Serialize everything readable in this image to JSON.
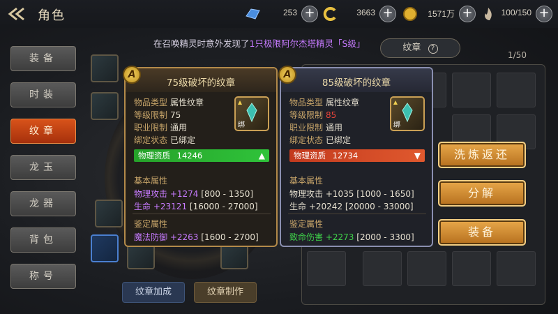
{
  "header": {
    "title": "角色"
  },
  "resources": [
    {
      "icon": "blue-crystal-icon",
      "value": "253"
    },
    {
      "icon": "gold-swirl-icon",
      "value": "3663"
    },
    {
      "icon": "gold-coin-icon",
      "value": "1571万"
    },
    {
      "icon": "flame-stamina-icon",
      "value": "100/150"
    }
  ],
  "notice": {
    "prefix": "在召唤精灵时意外发现了",
    "highlight": "1只极限阿尔杰塔精灵「S级」"
  },
  "tabs": [
    {
      "label": "装备",
      "active": false
    },
    {
      "label": "时装",
      "active": false
    },
    {
      "label": "纹章",
      "active": true
    },
    {
      "label": "龙玉",
      "active": false
    },
    {
      "label": "龙器",
      "active": false
    },
    {
      "label": "背包",
      "active": false
    },
    {
      "label": "称号",
      "active": false
    }
  ],
  "emblem_buttons": {
    "bonus": "纹章加成",
    "craft": "纹章制作"
  },
  "inventory": {
    "tab_label": "纹章",
    "count": "1/50"
  },
  "actions": {
    "refine": "洗炼返还",
    "decompose": "分解",
    "equip": "装备"
  },
  "tooltip_left": {
    "badge": "A",
    "title": "75级破坏的纹章",
    "bound_label": "绑",
    "rows": [
      {
        "k": "物品类型",
        "v": "属性纹章"
      },
      {
        "k": "等级限制",
        "v": "75"
      },
      {
        "k": "职业限制",
        "v": "通用"
      },
      {
        "k": "绑定状态",
        "v": "已绑定"
      }
    ],
    "quality": {
      "label": "物理资质",
      "value": "14246",
      "arrow": "▲"
    },
    "basic_title": "基本属性",
    "basic": [
      {
        "name": "物理攻击",
        "bonus": "+1274",
        "range": "[800 - 1350]"
      },
      {
        "name": "生命",
        "bonus": "+23121",
        "range": "[16000 - 27000]"
      }
    ],
    "appraise_title": "鉴定属性",
    "appraise": [
      {
        "name": "魔法防御",
        "bonus": "+2263",
        "range": "[1600 - 2700]"
      }
    ]
  },
  "tooltip_right": {
    "badge": "A",
    "title": "85级破坏的纹章",
    "bound_label": "绑",
    "rows": [
      {
        "k": "物品类型",
        "v": "属性纹章"
      },
      {
        "k": "等级限制",
        "v": "85"
      },
      {
        "k": "职业限制",
        "v": "通用"
      },
      {
        "k": "绑定状态",
        "v": "已绑定"
      }
    ],
    "quality": {
      "label": "物理资质",
      "value": "12734",
      "arrow": "▼"
    },
    "basic_title": "基本属性",
    "basic": [
      {
        "name": "物理攻击",
        "bonus": "+1035",
        "range": "[1000 - 1650]"
      },
      {
        "name": "生命",
        "bonus": "+20242",
        "range": "[20000 - 33000]"
      }
    ],
    "appraise_title": "鉴定属性",
    "appraise": [
      {
        "name": "致命伤害",
        "bonus": "+2273",
        "range": "[2000 - 3300]"
      }
    ]
  },
  "colors": {
    "active_tab": "#c7401a",
    "quality_up": "#2fc33a",
    "quality_down": "#e0592e",
    "level_warn": "#e8443a",
    "action_gold": "#d89232"
  }
}
